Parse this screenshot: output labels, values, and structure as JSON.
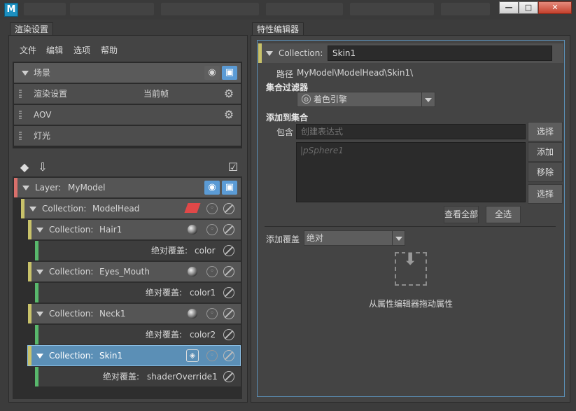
{
  "window": {
    "app_icon": "M",
    "minimize_label": "—",
    "maximize_label": "□",
    "close_label": "✕"
  },
  "left": {
    "tab_label": "渲染设置",
    "menu": [
      "文件",
      "编辑",
      "选项",
      "帮助"
    ],
    "scene": {
      "label": "场景",
      "rows": [
        {
          "label": "渲染设置",
          "value": "当前帧"
        },
        {
          "label": "AOV",
          "value": ""
        },
        {
          "label": "灯光",
          "value": ""
        }
      ]
    },
    "tree": {
      "layer_prefix": "Layer:",
      "layer_name": "MyModel",
      "collection_prefix": "Collection:",
      "override_prefix": "绝对覆盖:",
      "top_collection": "ModelHead",
      "children": [
        {
          "name": "Hair1",
          "override": "color"
        },
        {
          "name": "Eyes_Mouth",
          "override": "color1"
        },
        {
          "name": "Neck1",
          "override": "color2"
        },
        {
          "name": "Skin1",
          "override": "shaderOverride1"
        }
      ]
    },
    "colors": {
      "layer_bar": "#d9706b",
      "collection_bar": "#c8c26a",
      "override_bar": "#58b86c",
      "selected": "#5b8fb6"
    }
  },
  "right": {
    "tab_label": "特性编辑器",
    "collection_label": "Collection:",
    "collection_name": "Skin1",
    "path_label": "路径",
    "path_value": "MyModel\\ModelHead\\Skin1\\",
    "filter_label": "集合过滤器",
    "filter_value": "着色引擎",
    "add_label": "添加到集合",
    "include_label": "包含",
    "include_placeholder": "创建表达式",
    "list_item": "|pSphere1",
    "btn_select1": "选择",
    "btn_add": "添加",
    "btn_remove": "移除",
    "btn_select2": "选择",
    "btn_view_all": "查看全部",
    "btn_select_all": "全选",
    "override_label": "添加覆盖",
    "override_value": "绝对",
    "drag_hint": "从属性编辑器拖动属性"
  }
}
